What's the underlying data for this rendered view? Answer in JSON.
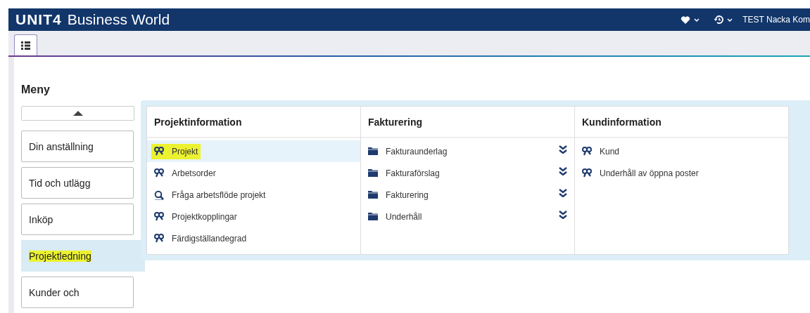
{
  "header": {
    "logo": "UNIT4",
    "product": "Business World",
    "user": "TEST Nacka Kom"
  },
  "tabs": [
    {
      "selected": true
    }
  ],
  "menu": {
    "title": "Meny",
    "sidebar": [
      {
        "label": "Din anställning",
        "selected": false,
        "highlighted": false
      },
      {
        "label": "Tid och utlägg",
        "selected": false,
        "highlighted": false
      },
      {
        "label": "Inköp",
        "selected": false,
        "highlighted": false
      },
      {
        "label": "Projektledning",
        "selected": true,
        "highlighted": true
      },
      {
        "label": "Kunder och",
        "selected": false,
        "highlighted": false
      }
    ],
    "columns": [
      {
        "title": "Projektinformation",
        "items": [
          {
            "kind": "task",
            "label": "Projekt",
            "selected": true,
            "highlighted": true
          },
          {
            "kind": "task",
            "label": "Arbetsorder",
            "selected": false,
            "highlighted": false
          },
          {
            "kind": "query",
            "label": "Fråga arbetsflöde projekt",
            "selected": false,
            "highlighted": false
          },
          {
            "kind": "task",
            "label": "Projektkopplingar",
            "selected": false,
            "highlighted": false
          },
          {
            "kind": "task",
            "label": "Färdigställandegrad",
            "selected": false,
            "highlighted": false
          }
        ]
      },
      {
        "title": "Fakturering",
        "items": [
          {
            "kind": "folder",
            "label": "Fakturaunderlag",
            "selected": false,
            "highlighted": false
          },
          {
            "kind": "folder",
            "label": "Fakturaförslag",
            "selected": false,
            "highlighted": false
          },
          {
            "kind": "folder",
            "label": "Fakturering",
            "selected": false,
            "highlighted": false
          },
          {
            "kind": "folder",
            "label": "Underhåll",
            "selected": false,
            "highlighted": false
          }
        ]
      },
      {
        "title": "Kundinformation",
        "items": [
          {
            "kind": "task",
            "label": "Kund",
            "selected": false,
            "highlighted": false
          },
          {
            "kind": "task",
            "label": "Underhåll av öppna poster",
            "selected": false,
            "highlighted": false
          }
        ]
      }
    ]
  }
}
